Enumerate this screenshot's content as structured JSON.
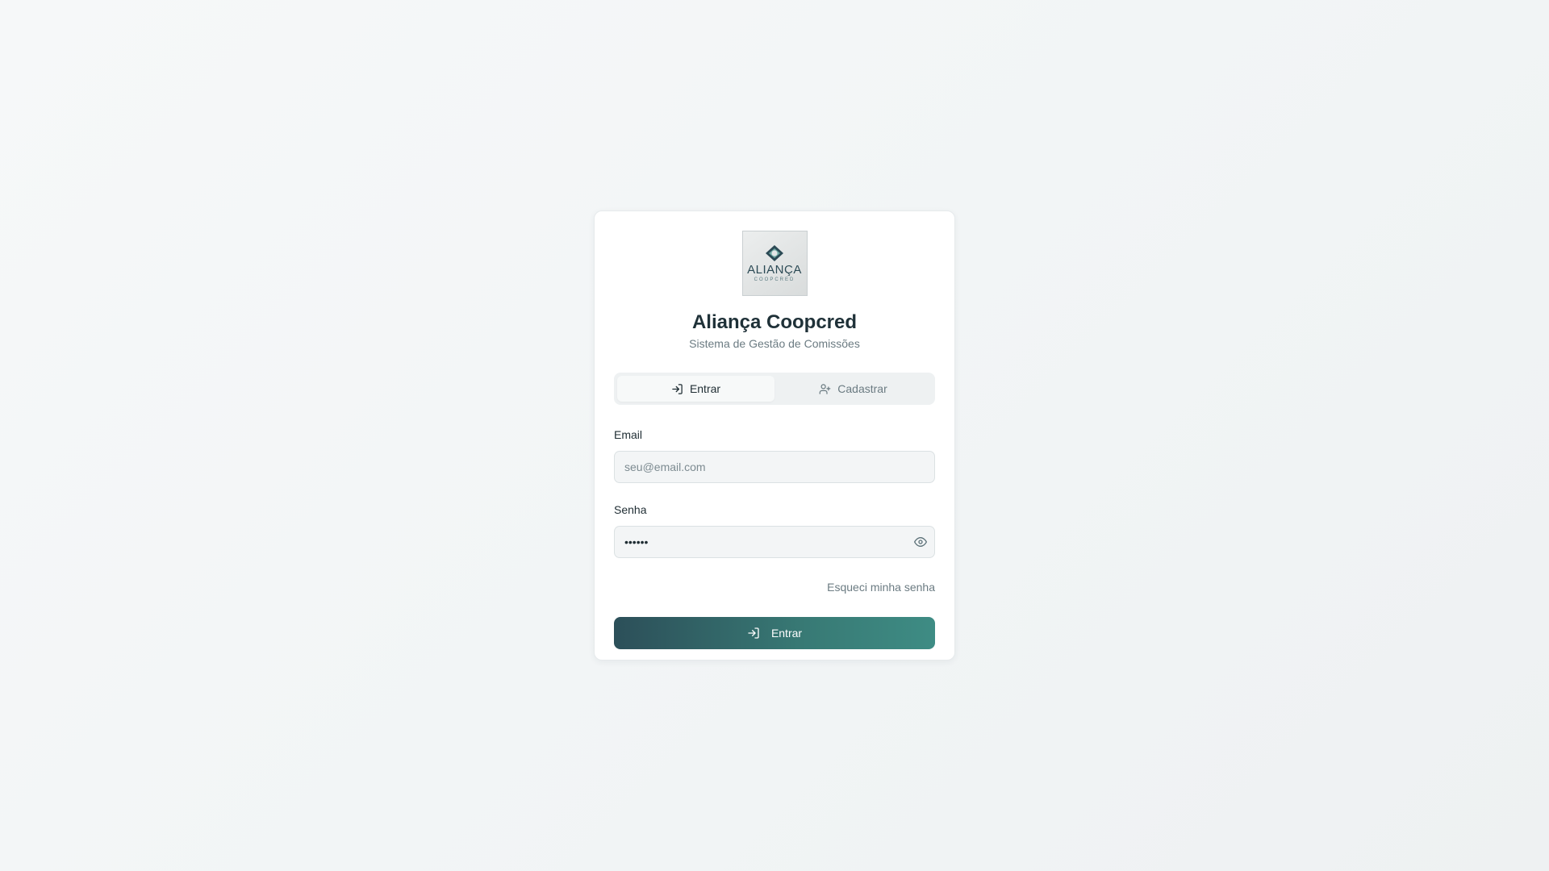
{
  "brand": {
    "logo_word": "ALIANÇA",
    "logo_sub": "COOPCRED",
    "title": "Aliança Coopcred",
    "subtitle": "Sistema de Gestão de Comissões"
  },
  "tabs": [
    {
      "label": "Entrar",
      "icon": "log-in-icon",
      "active": true
    },
    {
      "label": "Cadastrar",
      "icon": "user-plus-icon",
      "active": false
    }
  ],
  "form": {
    "email_label": "Email",
    "email_placeholder": "seu@email.com",
    "email_value": "",
    "password_label": "Senha",
    "password_value": "123456",
    "forgot_label": "Esqueci minha senha",
    "submit_label": "Entrar"
  },
  "colors": {
    "primary_start": "#2c4f59",
    "primary_end": "#3e8c84",
    "title": "#1f3138",
    "muted": "#6b7b82"
  }
}
